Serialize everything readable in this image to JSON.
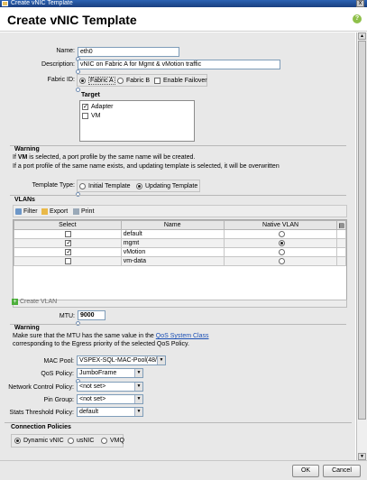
{
  "window": {
    "title": "Create vNIC Template",
    "close_glyph": "x"
  },
  "header": {
    "title": "Create vNIC Template",
    "help_glyph": "?"
  },
  "form": {
    "name_label": "Name:",
    "name_value": "eth0",
    "description_label": "Description:",
    "description_value": "vNIC on Fabric A for Mgmt & vMotion traffic",
    "fabric_label": "Fabric ID:",
    "fabric_a": "Fabric A",
    "fabric_b": "Fabric B",
    "enable_failover": "Enable Failover",
    "target_label": "Target",
    "target_adapter": "Adapter",
    "target_vm": "VM",
    "warning_title": "Warning",
    "warning_line1_pre": "If ",
    "warning_line1_bold": "VM",
    "warning_line1_post": " is selected, a port profile by the same name will be created.",
    "warning_line2": "If a port profile of the same name exists, and updating template is selected, it will be overwritten",
    "template_type_label": "Template Type:",
    "template_initial": "Initial Template",
    "template_updating": "Updating Template"
  },
  "vlans": {
    "title": "VLANs",
    "toolbar": {
      "filter": "Filter",
      "export": "Export",
      "print": "Print"
    },
    "columns": [
      "Select",
      "Name",
      "Native VLAN"
    ],
    "rows": [
      {
        "name": "default",
        "selected": false,
        "native": false
      },
      {
        "name": "mgmt",
        "selected": true,
        "native": true
      },
      {
        "name": "vMotion",
        "selected": true,
        "native": false
      },
      {
        "name": "vm-data",
        "selected": false,
        "native": false
      }
    ],
    "create_vlan": "Create VLAN"
  },
  "mtu": {
    "label": "MTU:",
    "value": "9000"
  },
  "warning2": {
    "title": "Warning",
    "line1_pre": "Make sure that the MTU has the same value in the ",
    "line1_link": "QoS System Class",
    "line2": "corresponding to the Egress priority of the selected QoS Policy."
  },
  "policies": {
    "mac_pool_label": "MAC Pool:",
    "mac_pool_value": "VSPEX-SQL-MAC-Pool(48/...",
    "qos_label": "QoS Policy:",
    "qos_value": "JumboFrame",
    "ncp_label": "Network Control Policy:",
    "ncp_value": "<not set>",
    "pin_label": "Pin Group:",
    "pin_value": "<not set>",
    "stats_label": "Stats Threshold Policy:",
    "stats_value": "default"
  },
  "connection": {
    "title": "Connection Policies",
    "dynamic_vnic": "Dynamic vNIC",
    "usnic": "usNIC",
    "vmq": "VMQ"
  },
  "footer": {
    "ok": "OK",
    "cancel": "Cancel"
  },
  "colors": {
    "titlebar": "#1a3f80",
    "form_bg": "#e8e8e8",
    "help": "#8fc04a",
    "link": "#1a4fb5",
    "create_vlan_icon": "#4caf3a"
  }
}
